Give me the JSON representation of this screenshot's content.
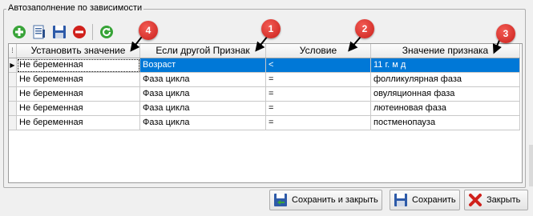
{
  "group": {
    "title": "Автозаполнение по зависимости"
  },
  "toolbar": {
    "icons": [
      "add-icon",
      "edit-icon",
      "save-icon",
      "delete-icon",
      "refresh-icon"
    ]
  },
  "grid": {
    "columns": [
      "⁞",
      "Установить значение",
      "Если другой Признак",
      "Условие",
      "Значение признака"
    ],
    "rows": [
      {
        "marker": "▶",
        "set": "Не беременная",
        "feature": "Возраст",
        "cond": "<",
        "value": "11  г.     м     д"
      },
      {
        "marker": "",
        "set": "Не беременная",
        "feature": "Фаза цикла",
        "cond": "=",
        "value": "фолликулярная фаза"
      },
      {
        "marker": "",
        "set": "Не беременная",
        "feature": "Фаза цикла",
        "cond": "=",
        "value": "овуляционная  фаза"
      },
      {
        "marker": "",
        "set": "Не беременная",
        "feature": "Фаза цикла",
        "cond": "=",
        "value": "лютеиновая  фаза"
      },
      {
        "marker": "",
        "set": "Не беременная",
        "feature": "Фаза цикла",
        "cond": "=",
        "value": "постменопауза"
      }
    ]
  },
  "badges": [
    "1",
    "2",
    "3",
    "4"
  ],
  "buttons": {
    "save_close": "Сохранить и закрыть",
    "save": "Сохранить",
    "close": "Закрыть"
  },
  "colors": {
    "selection": "#0078d7",
    "badge": "#d92b23"
  }
}
